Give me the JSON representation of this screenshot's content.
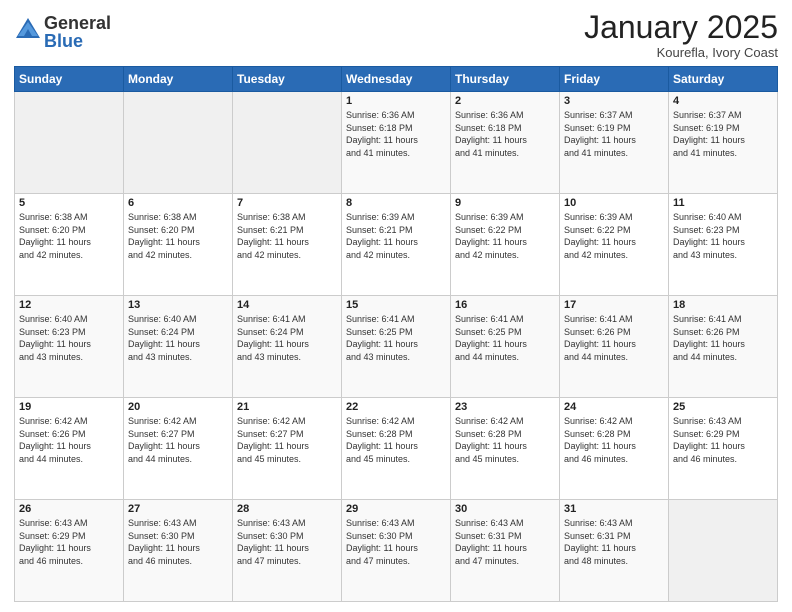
{
  "logo": {
    "general": "General",
    "blue": "Blue"
  },
  "header": {
    "month": "January 2025",
    "location": "Kourefla, Ivory Coast"
  },
  "days_of_week": [
    "Sunday",
    "Monday",
    "Tuesday",
    "Wednesday",
    "Thursday",
    "Friday",
    "Saturday"
  ],
  "weeks": [
    [
      {
        "day": "",
        "info": ""
      },
      {
        "day": "",
        "info": ""
      },
      {
        "day": "",
        "info": ""
      },
      {
        "day": "1",
        "info": "Sunrise: 6:36 AM\nSunset: 6:18 PM\nDaylight: 11 hours\nand 41 minutes."
      },
      {
        "day": "2",
        "info": "Sunrise: 6:36 AM\nSunset: 6:18 PM\nDaylight: 11 hours\nand 41 minutes."
      },
      {
        "day": "3",
        "info": "Sunrise: 6:37 AM\nSunset: 6:19 PM\nDaylight: 11 hours\nand 41 minutes."
      },
      {
        "day": "4",
        "info": "Sunrise: 6:37 AM\nSunset: 6:19 PM\nDaylight: 11 hours\nand 41 minutes."
      }
    ],
    [
      {
        "day": "5",
        "info": "Sunrise: 6:38 AM\nSunset: 6:20 PM\nDaylight: 11 hours\nand 42 minutes."
      },
      {
        "day": "6",
        "info": "Sunrise: 6:38 AM\nSunset: 6:20 PM\nDaylight: 11 hours\nand 42 minutes."
      },
      {
        "day": "7",
        "info": "Sunrise: 6:38 AM\nSunset: 6:21 PM\nDaylight: 11 hours\nand 42 minutes."
      },
      {
        "day": "8",
        "info": "Sunrise: 6:39 AM\nSunset: 6:21 PM\nDaylight: 11 hours\nand 42 minutes."
      },
      {
        "day": "9",
        "info": "Sunrise: 6:39 AM\nSunset: 6:22 PM\nDaylight: 11 hours\nand 42 minutes."
      },
      {
        "day": "10",
        "info": "Sunrise: 6:39 AM\nSunset: 6:22 PM\nDaylight: 11 hours\nand 42 minutes."
      },
      {
        "day": "11",
        "info": "Sunrise: 6:40 AM\nSunset: 6:23 PM\nDaylight: 11 hours\nand 43 minutes."
      }
    ],
    [
      {
        "day": "12",
        "info": "Sunrise: 6:40 AM\nSunset: 6:23 PM\nDaylight: 11 hours\nand 43 minutes."
      },
      {
        "day": "13",
        "info": "Sunrise: 6:40 AM\nSunset: 6:24 PM\nDaylight: 11 hours\nand 43 minutes."
      },
      {
        "day": "14",
        "info": "Sunrise: 6:41 AM\nSunset: 6:24 PM\nDaylight: 11 hours\nand 43 minutes."
      },
      {
        "day": "15",
        "info": "Sunrise: 6:41 AM\nSunset: 6:25 PM\nDaylight: 11 hours\nand 43 minutes."
      },
      {
        "day": "16",
        "info": "Sunrise: 6:41 AM\nSunset: 6:25 PM\nDaylight: 11 hours\nand 44 minutes."
      },
      {
        "day": "17",
        "info": "Sunrise: 6:41 AM\nSunset: 6:26 PM\nDaylight: 11 hours\nand 44 minutes."
      },
      {
        "day": "18",
        "info": "Sunrise: 6:41 AM\nSunset: 6:26 PM\nDaylight: 11 hours\nand 44 minutes."
      }
    ],
    [
      {
        "day": "19",
        "info": "Sunrise: 6:42 AM\nSunset: 6:26 PM\nDaylight: 11 hours\nand 44 minutes."
      },
      {
        "day": "20",
        "info": "Sunrise: 6:42 AM\nSunset: 6:27 PM\nDaylight: 11 hours\nand 44 minutes."
      },
      {
        "day": "21",
        "info": "Sunrise: 6:42 AM\nSunset: 6:27 PM\nDaylight: 11 hours\nand 45 minutes."
      },
      {
        "day": "22",
        "info": "Sunrise: 6:42 AM\nSunset: 6:28 PM\nDaylight: 11 hours\nand 45 minutes."
      },
      {
        "day": "23",
        "info": "Sunrise: 6:42 AM\nSunset: 6:28 PM\nDaylight: 11 hours\nand 45 minutes."
      },
      {
        "day": "24",
        "info": "Sunrise: 6:42 AM\nSunset: 6:28 PM\nDaylight: 11 hours\nand 46 minutes."
      },
      {
        "day": "25",
        "info": "Sunrise: 6:43 AM\nSunset: 6:29 PM\nDaylight: 11 hours\nand 46 minutes."
      }
    ],
    [
      {
        "day": "26",
        "info": "Sunrise: 6:43 AM\nSunset: 6:29 PM\nDaylight: 11 hours\nand 46 minutes."
      },
      {
        "day": "27",
        "info": "Sunrise: 6:43 AM\nSunset: 6:30 PM\nDaylight: 11 hours\nand 46 minutes."
      },
      {
        "day": "28",
        "info": "Sunrise: 6:43 AM\nSunset: 6:30 PM\nDaylight: 11 hours\nand 47 minutes."
      },
      {
        "day": "29",
        "info": "Sunrise: 6:43 AM\nSunset: 6:30 PM\nDaylight: 11 hours\nand 47 minutes."
      },
      {
        "day": "30",
        "info": "Sunrise: 6:43 AM\nSunset: 6:31 PM\nDaylight: 11 hours\nand 47 minutes."
      },
      {
        "day": "31",
        "info": "Sunrise: 6:43 AM\nSunset: 6:31 PM\nDaylight: 11 hours\nand 48 minutes."
      },
      {
        "day": "",
        "info": ""
      }
    ]
  ]
}
